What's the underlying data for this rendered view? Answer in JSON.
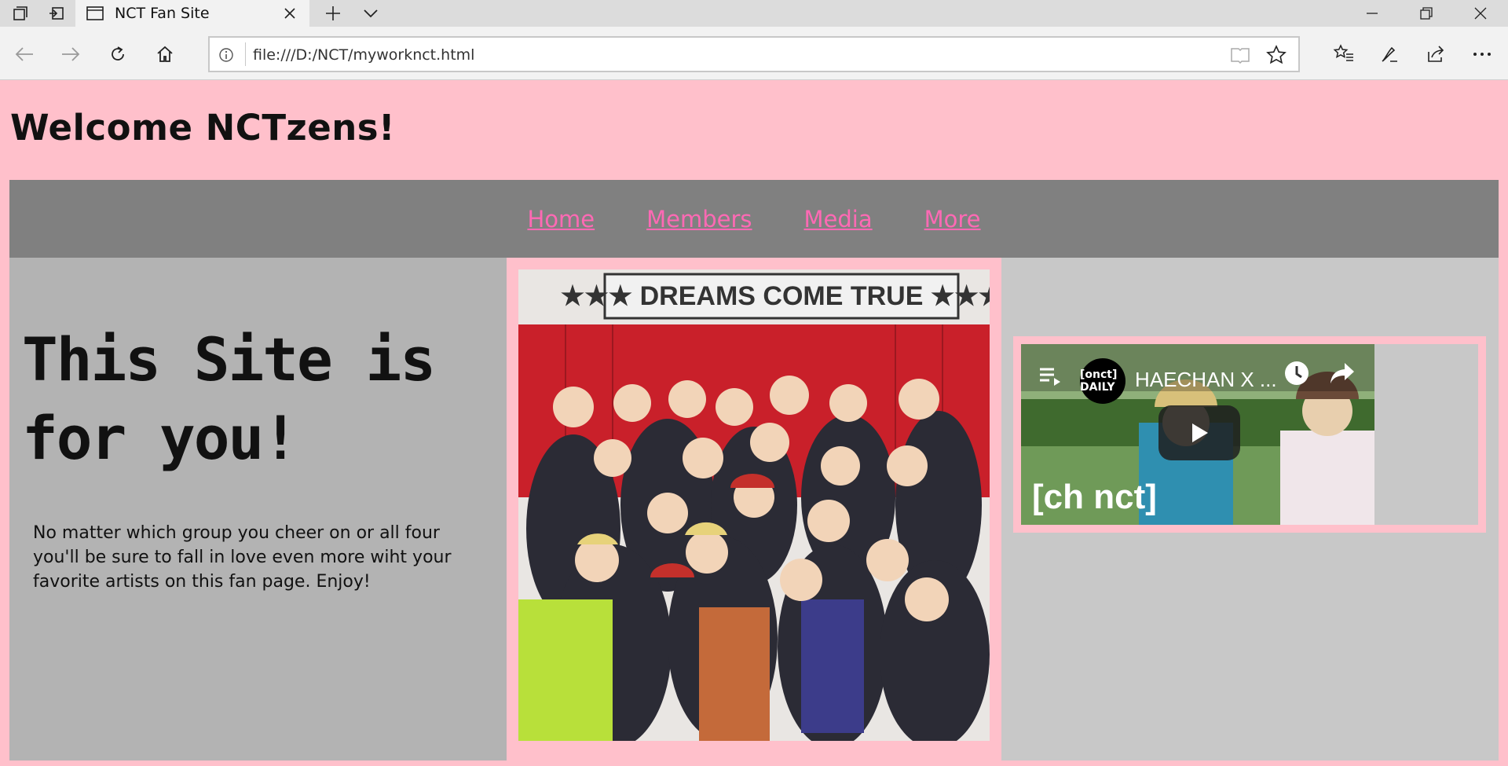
{
  "browser": {
    "tab_title": "NCT Fan Site",
    "url": "file:///D:/NCT/myworknct.html"
  },
  "page": {
    "heading": "Welcome NCTzens!",
    "nav": [
      "Home",
      "Members",
      "Media",
      "More"
    ],
    "hero": "This Site is for you!",
    "blurb": "No matter which group you cheer on or all four you'll be sure to fall in love even more wiht your favorite artists on this fan page. Enjoy!"
  },
  "photo": {
    "banner": "★★★ DREAMS COME TRUE ★★★"
  },
  "video": {
    "channel": "[ᴏnct] DAILY",
    "title": "HAECHAN X ...",
    "watermark": "[ch nct]"
  },
  "colors": {
    "page_bg": "#ffc0cb",
    "nav_bg": "#808080",
    "link": "#ff69b4",
    "left_col": "#b3b3b3",
    "right_col": "#c8c8c8"
  }
}
